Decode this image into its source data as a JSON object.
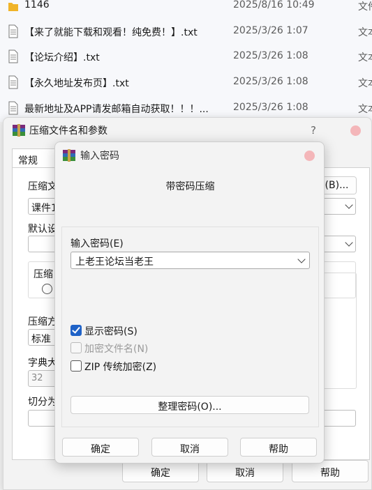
{
  "file_list": [
    {
      "name": "1146",
      "date": "2025/8/16 10:49",
      "type": "文件",
      "icon": "folder-icon"
    },
    {
      "name": "【来了就能下载和观看！纯免费！】.txt",
      "date": "2025/3/26 1:07",
      "type": "文本",
      "icon": "text-file-icon"
    },
    {
      "name": "【论坛介绍】.txt",
      "date": "2025/3/26 1:08",
      "type": "文本",
      "icon": "text-file-icon"
    },
    {
      "name": "【永久地址发布页】.txt",
      "date": "2025/3/26 1:08",
      "type": "文本",
      "icon": "text-file-icon"
    },
    {
      "name": "最新地址及APP请发邮箱自动获取！！！...",
      "date": "2025/3/26 1:08",
      "type": "文本",
      "icon": "text-file-icon"
    }
  ],
  "main_dialog": {
    "title": "压缩文件名和参数",
    "help_glyph": "?",
    "tab_general": "常规",
    "archive_name_label": "压缩文",
    "archive_name_value": "课件1",
    "browse_button": "(B)...",
    "default_profile_label": "默认设",
    "format_group_label": "压缩",
    "method_label": "压缩方",
    "method_value": "标准",
    "dict_label": "字典大",
    "dict_value": "32",
    "split_label": "切分为",
    "ok_button": "确定",
    "cancel_button": "取消",
    "help_button": "帮助"
  },
  "password_dialog": {
    "title": "输入密码",
    "heading": "带密码压缩",
    "password_label": "输入密码(E)",
    "password_value": "上老王论坛当老王",
    "show_password_label": "显示密码(S)",
    "show_password_checked": true,
    "encrypt_names_label": "加密文件名(N)",
    "encrypt_names_checked": false,
    "encrypt_names_enabled": false,
    "zip_legacy_label": "ZIP 传统加密(Z)",
    "zip_legacy_checked": false,
    "organize_button": "整理密码(O)...",
    "ok_button": "确定",
    "cancel_button": "取消",
    "help_button": "帮助"
  },
  "colors": {
    "accent": "#1f62c7",
    "close_dot": "#f4b6b9",
    "folder": "#f0b429"
  }
}
